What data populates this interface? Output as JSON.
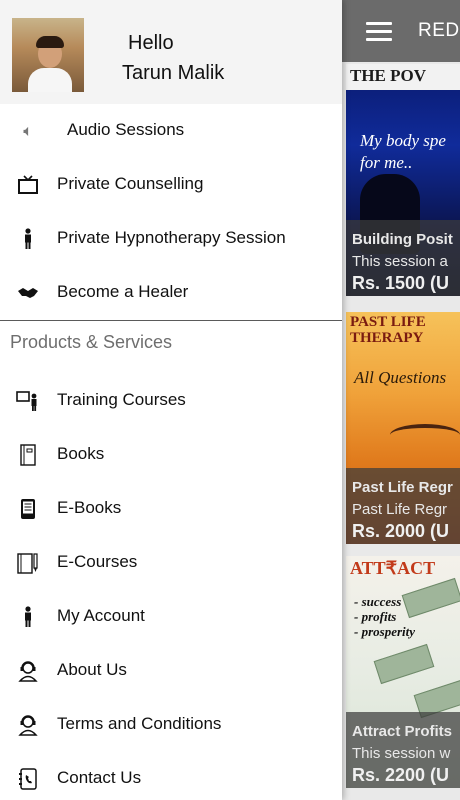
{
  "underlay": {
    "appbar_title": "REDC",
    "cards": [
      {
        "headline": "THE POV",
        "script": "My body spe\nfor me..",
        "title": "Building Posit",
        "subtitle": "This session a",
        "price": "Rs. 1500 (U"
      },
      {
        "headline": "PAST LIFE THERAPY",
        "script": "All Questions",
        "title": "Past Life Regr",
        "subtitle": "Past Life Regr",
        "price": "Rs. 2000 (U"
      },
      {
        "headline": "ATT₹ACT",
        "script": "- success\n- profits\n- prosperity",
        "title": "Attract Profits",
        "subtitle": "This session w",
        "price": "Rs. 2200 (U"
      }
    ]
  },
  "drawer": {
    "greeting": "Hello",
    "username": "Tarun Malik",
    "items": [
      {
        "label": "Audio Sessions",
        "icon": "speaker-icon"
      },
      {
        "label": "Private Counselling",
        "icon": "tv-icon"
      },
      {
        "label": "Private Hypnotherapy Session",
        "icon": "person-icon"
      },
      {
        "label": "Become a Healer",
        "icon": "handshake-icon"
      }
    ],
    "section_title": "Products & Services",
    "products": [
      {
        "label": "Training Courses",
        "icon": "presenter-icon"
      },
      {
        "label": "Books",
        "icon": "book-icon"
      },
      {
        "label": "E-Books",
        "icon": "ebook-reader-icon"
      },
      {
        "label": "E-Courses",
        "icon": "ecourse-icon"
      },
      {
        "label": "My Account",
        "icon": "person-icon"
      },
      {
        "label": "About Us",
        "icon": "support-agent-icon"
      },
      {
        "label": "Terms and Conditions",
        "icon": "support-agent-icon"
      },
      {
        "label": "Contact Us",
        "icon": "contact-book-icon"
      }
    ]
  },
  "colors": {
    "appbar": "#6b6b6b",
    "drawer_header": "#f4f4f4",
    "section_title": "#6e6e6e",
    "divider": "#5a5a5a"
  }
}
